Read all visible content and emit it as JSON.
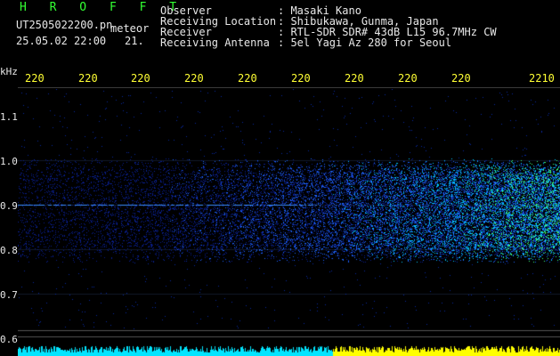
{
  "header": {
    "app_name": "H R O F F T",
    "filename": "UT2505022200.pn",
    "mode": "meteor",
    "timestamp": "25.05.02 22:00",
    "minute": "21.",
    "fields": [
      {
        "label": "Observer",
        "value": ": Masaki Kano"
      },
      {
        "label": "Receiving Location",
        "value": ": Shibukawa, Gunma, Japan"
      },
      {
        "label": "Receiver",
        "value": ": RTL-SDR SDR# 43dB L15 96.7MHz CW"
      },
      {
        "label": "Receiving Antenna",
        "value": ": 5el Yagi Az 280 for Seoul"
      }
    ]
  },
  "x_axis": {
    "tick_labels": [
      "220",
      "220",
      "220",
      "220",
      "220",
      "220",
      "220",
      "220",
      "220",
      "2210"
    ]
  },
  "y_axis": {
    "unit": "kHz",
    "tick_labels": [
      "1.1",
      "1.0",
      "0.9",
      "0.8",
      "0.7",
      "0.6"
    ]
  },
  "colors": {
    "background": "#000000",
    "header_text": "#e8e8e8",
    "time_labels": "#ffff33",
    "title": "#33ff33",
    "signal_low": "#0a1e8c",
    "signal_mid": "#1e64ff",
    "signal_high": "#00e0ff",
    "signal_peak": "#33ff66",
    "bottom_bar_left": "#00e5ff",
    "bottom_bar_right": "#ffff00"
  }
}
